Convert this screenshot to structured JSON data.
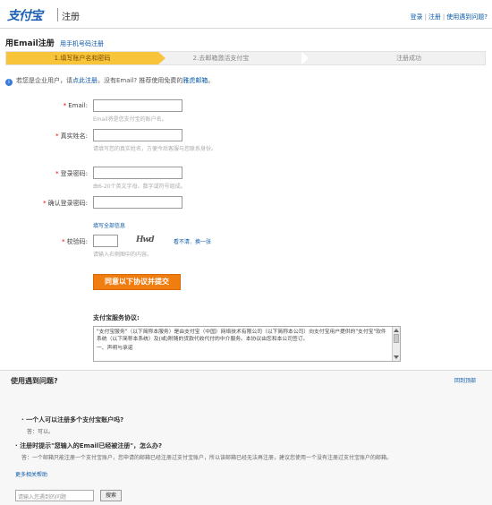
{
  "header": {
    "logo": "支付宝",
    "title": "注册",
    "links": [
      "登录",
      "注册",
      "使用遇到问题?"
    ]
  },
  "page": {
    "title": "用Email注册",
    "alt_link": "用手机号码注册"
  },
  "steps": [
    "1.填写账户名和密码",
    "2.去邮箱激活支付宝",
    "注册成功"
  ],
  "note": {
    "text_before": "若您是企业用户，请",
    "link1": "点此注册",
    "text_middle": "。没有Email? 推荐使用免费的",
    "link2": "雅虎邮箱",
    "text_after": "。"
  },
  "form": {
    "email": {
      "label": "Email:",
      "hint": "Email将是您支付宝的账户名。"
    },
    "realname": {
      "label": "真实姓名:",
      "hint": "请填写您的真实姓名，方便今后客服与您联系身份。"
    },
    "password": {
      "label": "登录密码:",
      "hint": "由6-20个英文字母、数字或符号组成。"
    },
    "confirm": {
      "label": "确认登录密码:"
    },
    "fill_all": "填写全部信息",
    "captcha": {
      "label": "校验码:",
      "image_text": "Hwd",
      "link_a": "看不清",
      "link_b": "换一张",
      "hint": "请输入右侧图中的内容。"
    },
    "submit": "同意以下协议并提交"
  },
  "agreement": {
    "title": "支付宝服务协议:",
    "text": "\"支付宝服务\"（以下简称本服务）是由支付宝（中国）网络技术有限公司（以下简称本公司）向支付宝用户提供的\"支付宝\"软件系统（以下简称本系统）及(或)附随的货款代收代付的中介服务。本协议由您和本公司签订。",
    "section": "一、声明与承诺"
  },
  "help": {
    "title": "使用遇到问题?",
    "back_top": "回到顶部",
    "q1": "一个人可以注册多个支付宝账户吗?",
    "a1": "答：可以。",
    "q2": "注册时提示\"您输入的Email已经被注册\"，怎么办?",
    "a2": "答：一个邮箱只能注册一个支付宝账户，您申请的邮箱已经注册过支付宝账户，所以该邮箱已经无法再注册，建议您使用一个没有注册过支付宝账户的邮箱。",
    "more": "更多相关帮助",
    "search_placeholder": "请输入您遇到的问题",
    "search_button": "搜索"
  },
  "colors": {
    "brand_blue": "#1a5fb4",
    "step_active": "#f8c53a",
    "submit_orange": "#f07d10",
    "link": "#0b5aa8",
    "required": "#e00000"
  }
}
